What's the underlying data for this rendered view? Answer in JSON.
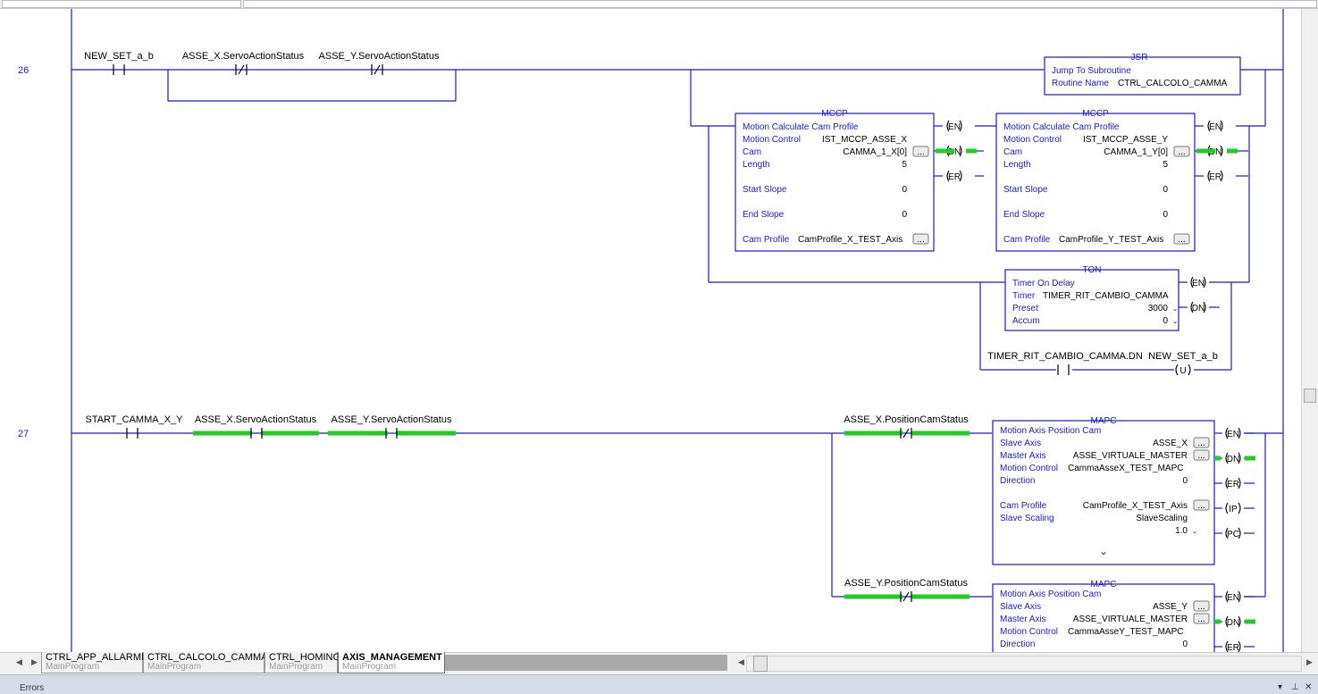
{
  "colors": {
    "wire": "#1a1ac8",
    "text_blue": "#1a1ac8",
    "energized": "#22cc22",
    "black": "#000000"
  },
  "rungs": [
    {
      "number": "26",
      "contacts": [
        {
          "tag": "NEW_SET_a_b",
          "type": "XIC"
        },
        {
          "tag": "ASSE_X.ServoActionStatus",
          "type": "XIO"
        },
        {
          "tag": "ASSE_Y.ServoActionStatus",
          "type": "XIO"
        }
      ],
      "jsr": {
        "title": "JSR",
        "rows": [
          {
            "label": "Jump To Subroutine",
            "value": ""
          },
          {
            "label": "Routine Name",
            "value": "CTRL_CALCOLO_CAMMA"
          }
        ]
      },
      "mccp": [
        {
          "title": "MCCP",
          "rows": [
            {
              "label": "Motion Calculate Cam Profile",
              "value": ""
            },
            {
              "label": "Motion Control",
              "value": "IST_MCCP_ASSE_X"
            },
            {
              "label": "Cam",
              "value": "CAMMA_1_X[0]"
            },
            {
              "label": "Length",
              "value": "5"
            },
            {
              "label": "Start Slope",
              "value": "0"
            },
            {
              "label": "End Slope",
              "value": "0"
            },
            {
              "label": "Cam Profile",
              "value": "CamProfile_X_TEST_Axis"
            }
          ],
          "outputs": [
            "EN",
            "DN",
            "ER"
          ]
        },
        {
          "title": "MCCP",
          "rows": [
            {
              "label": "Motion Calculate Cam Profile",
              "value": ""
            },
            {
              "label": "Motion Control",
              "value": "IST_MCCP_ASSE_Y"
            },
            {
              "label": "Cam",
              "value": "CAMMA_1_Y[0]"
            },
            {
              "label": "Length",
              "value": "5"
            },
            {
              "label": "Start Slope",
              "value": "0"
            },
            {
              "label": "End Slope",
              "value": "0"
            },
            {
              "label": "Cam Profile",
              "value": "CamProfile_Y_TEST_Axis"
            }
          ],
          "outputs": [
            "EN",
            "DN",
            "ER"
          ]
        }
      ],
      "ton": {
        "title": "TON",
        "rows": [
          {
            "label": "Timer On Delay",
            "value": ""
          },
          {
            "label": "Timer",
            "value": "TIMER_RIT_CAMBIO_CAMMA"
          },
          {
            "label": "Preset",
            "value": "3000"
          },
          {
            "label": "Accum",
            "value": "0"
          }
        ],
        "outputs": [
          "EN",
          "DN"
        ]
      },
      "timer_contact": "TIMER_RIT_CAMBIO_CAMMA.DN",
      "unlatch_coil": {
        "tag": "NEW_SET_a_b",
        "symbol": "U"
      }
    },
    {
      "number": "27",
      "contacts": [
        {
          "tag": "START_CAMMA_X_Y",
          "type": "XIC"
        },
        {
          "tag": "ASSE_X.ServoActionStatus",
          "type": "XIC"
        },
        {
          "tag": "ASSE_Y.ServoActionStatus",
          "type": "XIC"
        }
      ],
      "branch_contacts": [
        "ASSE_X.PositionCamStatus",
        "ASSE_Y.PositionCamStatus"
      ],
      "mapc": [
        {
          "title": "MAPC",
          "rows": [
            {
              "label": "Motion Axis Position Cam",
              "value": ""
            },
            {
              "label": "Slave Axis",
              "value": "ASSE_X"
            },
            {
              "label": "Master Axis",
              "value": "ASSE_VIRTUALE_MASTER"
            },
            {
              "label": "Motion Control",
              "value": "CammaAsseX_TEST_MAPC"
            },
            {
              "label": "Direction",
              "value": "0"
            },
            {
              "label": "Cam Profile",
              "value": "CamProfile_X_TEST_Axis"
            },
            {
              "label": "Slave Scaling",
              "value": "SlaveScaling"
            },
            {
              "label": "",
              "value": "1.0"
            }
          ],
          "outputs": [
            "EN",
            "DN",
            "ER",
            "IP",
            "PC"
          ]
        },
        {
          "title": "MAPC",
          "rows": [
            {
              "label": "Motion Axis Position Cam",
              "value": ""
            },
            {
              "label": "Slave Axis",
              "value": "ASSE_Y"
            },
            {
              "label": "Master Axis",
              "value": "ASSE_VIRTUALE_MASTER"
            },
            {
              "label": "Motion Control",
              "value": "CammaAsseY_TEST_MAPC"
            },
            {
              "label": "Direction",
              "value": "0"
            }
          ],
          "outputs": [
            "EN",
            "DN",
            "ER"
          ]
        }
      ]
    }
  ],
  "ellipsis": "...",
  "expand_glyph": "⌄",
  "tabs": [
    {
      "name": "CTRL_APP_ALLARMI",
      "program": "MainProgram"
    },
    {
      "name": "CTRL_CALCOLO_CAMMA",
      "program": "MainProgram"
    },
    {
      "name": "CTRL_HOMING",
      "program": "MainProgram"
    },
    {
      "name": "AXIS_MANAGEMENT",
      "program": "MainProgram"
    }
  ],
  "active_tab": "AXIS_MANAGEMENT",
  "statusbar": {
    "label": "Errors",
    "controls": [
      "▾",
      "⊥",
      "✕"
    ]
  }
}
